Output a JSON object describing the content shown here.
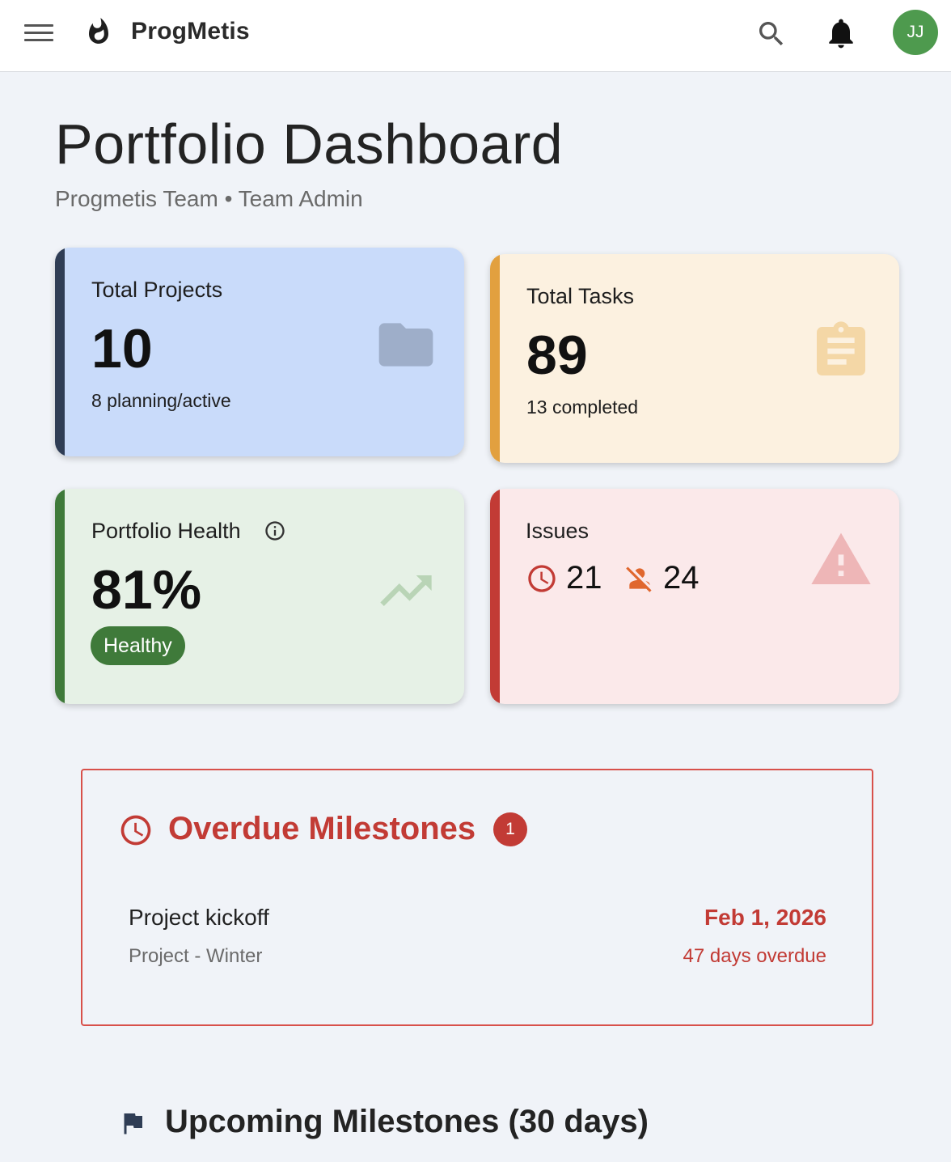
{
  "header": {
    "brand": "ProgMetis",
    "avatar_initials": "JJ",
    "icons": [
      "menu-icon",
      "flame-icon",
      "search-icon",
      "bell-icon"
    ],
    "avatar_color": "#4e9a4e"
  },
  "page": {
    "title": "Portfolio Dashboard",
    "subtitle": "Progmetis Team • Team Admin"
  },
  "cards": {
    "projects": {
      "label": "Total Projects",
      "value": "10",
      "sub": "8 planning/active",
      "icon": "folder-icon",
      "accent": "#2f3d55"
    },
    "tasks": {
      "label": "Total Tasks",
      "value": "89",
      "sub": "13 completed",
      "icon": "clipboard-icon",
      "accent": "#e2a03f"
    },
    "health": {
      "label": "Portfolio Health",
      "value": "81%",
      "badge": "Healthy",
      "icon": "trending-up-icon",
      "accent": "#3f7a3a"
    },
    "issues": {
      "label": "Issues",
      "overdue_count": "21",
      "unassigned_count": "24",
      "icon": "warning-icon",
      "accent": "#c23b35"
    }
  },
  "overdue": {
    "title": "Overdue Milestones",
    "count": "1",
    "items": [
      {
        "name": "Project kickoff",
        "project": "Project - Winter",
        "date": "Feb 1, 2026",
        "status": "47 days overdue"
      }
    ]
  },
  "upcoming": {
    "title": "Upcoming Milestones (30 days)"
  }
}
